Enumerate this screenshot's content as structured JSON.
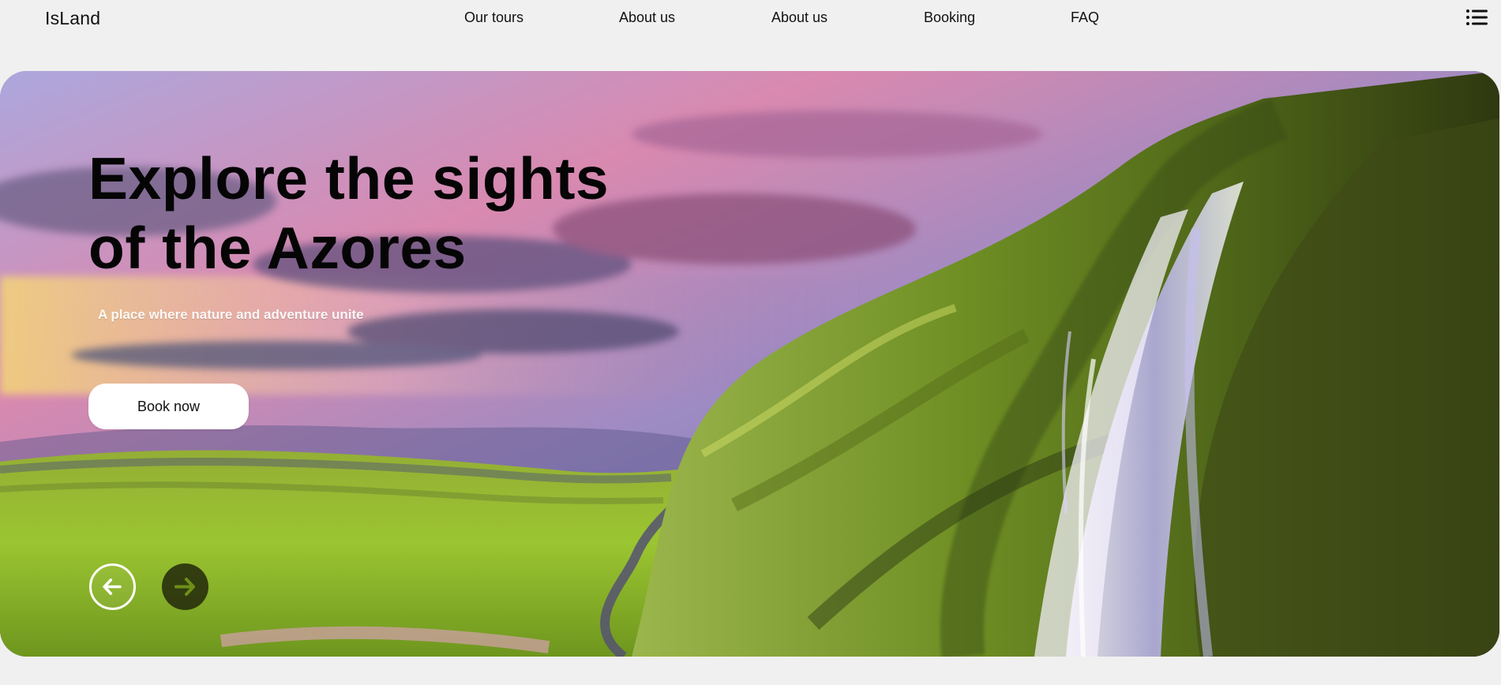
{
  "site": {
    "logo": "IsLand"
  },
  "nav": {
    "items": [
      {
        "label": "Our tours"
      },
      {
        "label": "About us"
      },
      {
        "label": "About us"
      },
      {
        "label": "Booking"
      },
      {
        "label": "FAQ"
      }
    ],
    "menu_icon": "menu-lines-icon"
  },
  "hero": {
    "title_line_1": "Explore the sights",
    "title_line_2": "of the Azores",
    "subtitle": "A place where nature and adventure unite",
    "cta_label": "Book now",
    "previous_icon": "arrow-left-icon",
    "next_icon": "arrow-right-icon"
  },
  "colors": {
    "page_background": "#f0f0f0",
    "hero_sky": "#7f75c8",
    "hero_grass": "#8fbd2d",
    "next_arrow": "#6f8f18"
  }
}
